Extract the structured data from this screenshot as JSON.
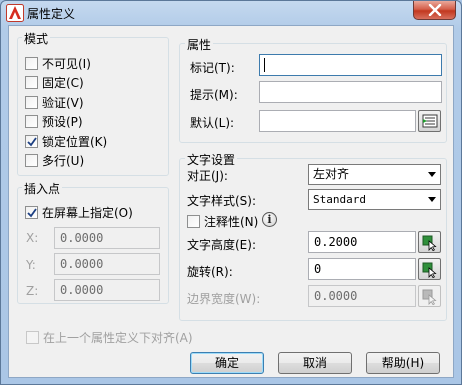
{
  "window": {
    "title": "属性定义",
    "close_icon": "close-icon"
  },
  "mode": {
    "group_title": "模式",
    "options": [
      {
        "label": "不可见(I)",
        "checked": false
      },
      {
        "label": "固定(C)",
        "checked": false
      },
      {
        "label": "验证(V)",
        "checked": false
      },
      {
        "label": "预设(P)",
        "checked": false
      },
      {
        "label": "锁定位置(K)",
        "checked": true
      },
      {
        "label": "多行(U)",
        "checked": false
      }
    ]
  },
  "attribute": {
    "group_title": "属性",
    "tag_label": "标记(T):",
    "tag_value": "",
    "prompt_label": "提示(M):",
    "prompt_value": "",
    "default_label": "默认(L):",
    "default_value": "",
    "insert_field_icon": "insert-field-icon"
  },
  "insertion_point": {
    "group_title": "插入点",
    "specify_on_screen_label": "在屏幕上指定(O)",
    "specify_on_screen_checked": true,
    "x_label": "X:",
    "x_value": "0.0000",
    "y_label": "Y:",
    "y_value": "0.0000",
    "z_label": "Z:",
    "z_value": "0.0000"
  },
  "text_settings": {
    "group_title": "文字设置",
    "justification_label": "对正(J):",
    "justification_value": "左对齐",
    "text_style_label": "文字样式(S):",
    "text_style_value": "Standard",
    "annotative_label": "注释性(N)",
    "annotative_checked": false,
    "info_icon": "info-icon",
    "text_height_label": "文字高度(E):",
    "text_height_value": "0.2000",
    "rotation_label": "旋转(R):",
    "rotation_value": "0",
    "boundary_width_label": "边界宽度(W):",
    "boundary_width_value": "0.0000",
    "pick_icon": "pick-point-icon"
  },
  "align_below_label": "在上一个属性定义下对齐(A)",
  "align_below_checked": false,
  "buttons": {
    "ok": "确定",
    "cancel": "取消",
    "help": "帮助(H)"
  }
}
